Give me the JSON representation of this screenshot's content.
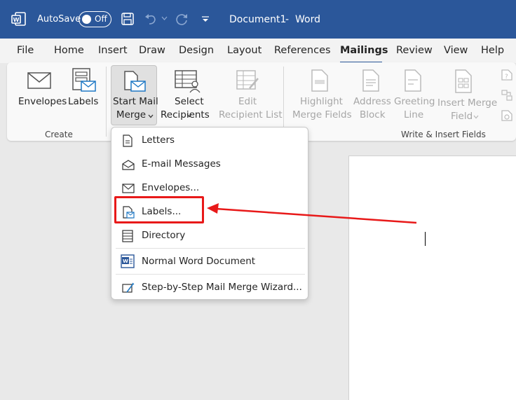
{
  "titlebar": {
    "autosave_label": "AutoSave",
    "autosave_state": "Off",
    "document_title": "Document1",
    "separator": "-",
    "app_name": "Word",
    "bg_color": "#2b579a"
  },
  "tabs": [
    {
      "label": "File"
    },
    {
      "label": "Home"
    },
    {
      "label": "Insert"
    },
    {
      "label": "Draw"
    },
    {
      "label": "Design"
    },
    {
      "label": "Layout"
    },
    {
      "label": "References"
    },
    {
      "label": "Mailings",
      "active": true
    },
    {
      "label": "Review"
    },
    {
      "label": "View"
    },
    {
      "label": "Help"
    }
  ],
  "ribbon": {
    "envelopes": "Envelopes",
    "labels": "Labels",
    "group_create": "Create",
    "start_mail_1": "Start Mail",
    "start_mail_2": "Merge",
    "select_1": "Select",
    "select_2": "Recipients",
    "edit_1": "Edit",
    "edit_2": "Recipient List",
    "highlight_1": "Highlight",
    "highlight_2": "Merge Fields",
    "address_1": "Address",
    "address_2": "Block",
    "greeting_1": "Greeting",
    "greeting_2": "Line",
    "insert_1": "Insert Merge",
    "insert_2": "Field",
    "group_write": "Write & Insert Fields"
  },
  "menu": {
    "items": [
      {
        "label": "Letters",
        "icon": "letter-icon"
      },
      {
        "label": "E-mail Messages",
        "icon": "email-open-icon"
      },
      {
        "label": "Envelopes...",
        "icon": "envelope-icon"
      },
      {
        "label": "Labels...",
        "icon": "labels-icon",
        "highlighted": true
      },
      {
        "label": "Directory",
        "icon": "directory-icon"
      },
      {
        "label": "Normal Word Document",
        "icon": "word-document-icon"
      },
      {
        "label": "Step-by-Step Mail Merge Wizard...",
        "icon": "wizard-icon"
      }
    ]
  },
  "colors": {
    "accent": "#2b579a",
    "annotation": "#e81919"
  }
}
